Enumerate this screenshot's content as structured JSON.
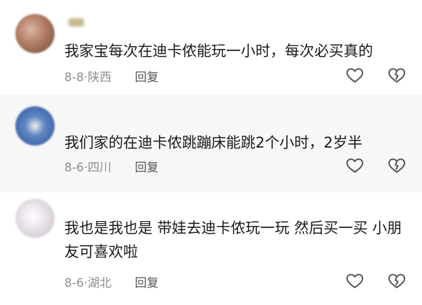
{
  "comments": [
    {
      "username": "",
      "text": "我家宝每次在迪卡侬能玩一小时，每次必买真的",
      "date": "8-8",
      "location": "陕西",
      "reply_label": "回复"
    },
    {
      "username": "",
      "text": "我们家的在迪卡侬跳蹦床能跳2个小时，2岁半",
      "date": "8-6",
      "location": "四川",
      "reply_label": "回复"
    },
    {
      "username": "",
      "text": "我也是我也是 带娃去迪卡侬玩一玩 然后买一买 小朋友可喜欢啦",
      "date": "8-6",
      "location": "湖北",
      "reply_label": "回复"
    }
  ],
  "meta_separator": "·",
  "icons": {
    "like": "heart-icon",
    "dislike": "broken-heart-icon"
  },
  "colors": {
    "meta": "#8e8e8e",
    "text": "#1a1a1a",
    "icon_stroke": "#555555"
  }
}
